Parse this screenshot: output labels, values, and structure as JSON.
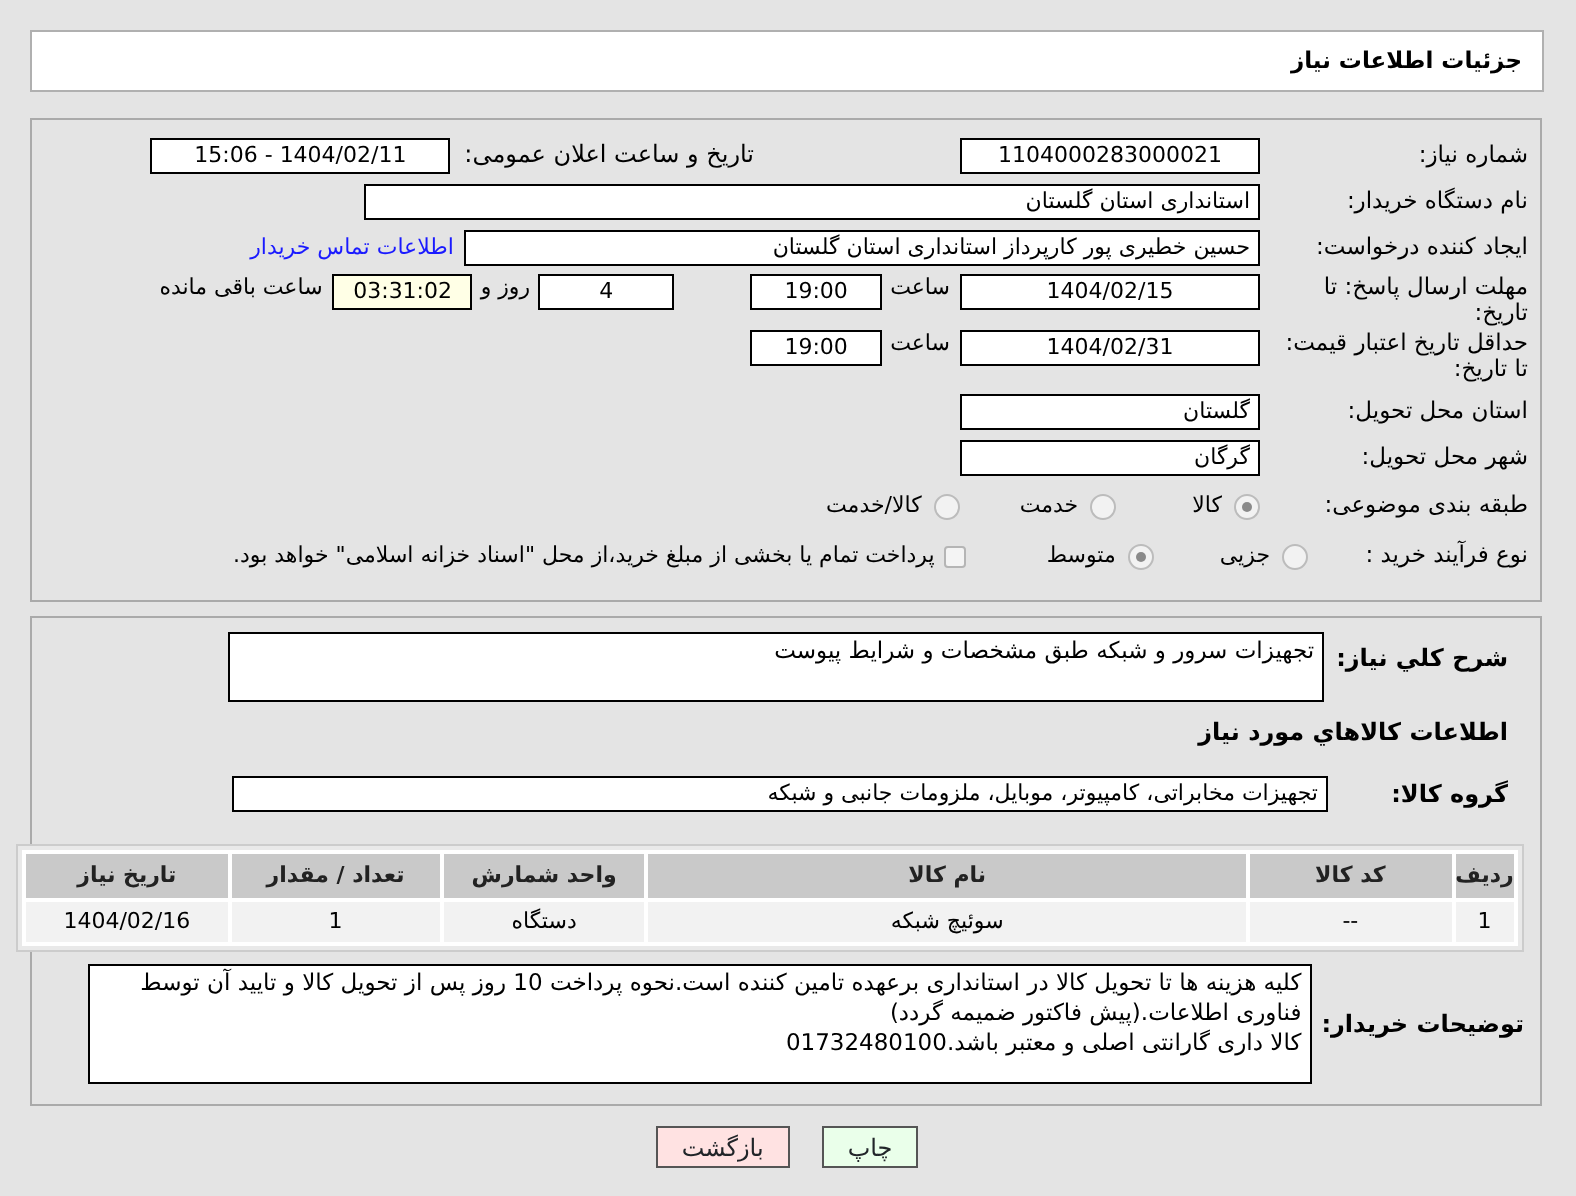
{
  "header": {
    "title": "جزئیات اطلاعات نیاز"
  },
  "need_info": {
    "need_number": {
      "label": "شماره نیاز:",
      "value": "1104000283000021"
    },
    "announce_datetime": {
      "label": "تاریخ و ساعت اعلان عمومی:",
      "value": "1404/02/11 - 15:06"
    },
    "buyer_org": {
      "label": "نام دستگاه خریدار:",
      "value": "استانداری استان گلستان"
    },
    "requester": {
      "label": "ایجاد کننده درخواست:",
      "value": "حسین خطیری پور کارپرداز استانداری استان گلستان",
      "contact_link": "اطلاعات تماس خریدار"
    },
    "response_deadline": {
      "label": "مهلت ارسال پاسخ: تا تاریخ:",
      "date": "1404/02/15",
      "time_label": "ساعت",
      "time": "19:00",
      "days": "4",
      "days_label": "روز و",
      "remaining": "03:31:02",
      "remaining_label": "ساعت باقی مانده"
    },
    "price_validity": {
      "label": "حداقل تاریخ اعتبار قیمت: تا تاریخ:",
      "date": "1404/02/31",
      "time_label": "ساعت",
      "time": "19:00"
    },
    "delivery_province": {
      "label": "استان محل تحویل:",
      "value": "گلستان"
    },
    "delivery_city": {
      "label": "شهر محل تحویل:",
      "value": "گرگان"
    },
    "subject_category": {
      "label": "طبقه بندی موضوعی:",
      "options": [
        {
          "label": "کالا",
          "selected": true
        },
        {
          "label": "خدمت",
          "selected": false
        },
        {
          "label": "کالا/خدمت",
          "selected": false
        }
      ]
    },
    "purchase_process": {
      "label": "نوع فرآیند خرید :",
      "options": [
        {
          "label": "جزیی",
          "selected": false
        },
        {
          "label": "متوسط",
          "selected": true
        }
      ],
      "treasury_note": {
        "label": "پرداخت تمام یا بخشی از مبلغ خرید،از محل \"اسناد خزانه اسلامی\" خواهد بود.",
        "checked": false
      }
    }
  },
  "description": {
    "label": "شرح كلي نياز:",
    "value": "تجهیزات سرور و شبکه طبق مشخصات و شرایط پیوست"
  },
  "goods_heading": "اطلاعات كالاهاي مورد نياز",
  "goods_group": {
    "label": "گروه کالا:",
    "value": "تجهیزات مخابراتی، کامپیوتر، موبایل، ملزومات جانبی و شبکه"
  },
  "goods_table": {
    "columns": [
      "ردیف",
      "کد کالا",
      "نام کالا",
      "واحد شمارش",
      "تعداد / مقدار",
      "تاریخ نیاز"
    ],
    "rows": [
      [
        "1",
        "--",
        "سوئیچ شبکه",
        "دستگاه",
        "1",
        "1404/02/16"
      ]
    ]
  },
  "buyer_notes": {
    "label": "توضیحات خریدار:",
    "value": "کلیه هزینه ها تا تحویل کالا در استانداری برعهده تامین کننده است.نحوه پرداخت 10 روز پس از تحویل کالا و تایید آن توسط فناوری اطلاعات.(پیش فاکتور ضمیمه گردد)\nکالا داری گارانتی اصلی و معتبر باشد.01732480100"
  },
  "buttons": [
    {
      "label": "چاپ",
      "kind": "print"
    },
    {
      "label": "بازگشت",
      "kind": "back"
    }
  ]
}
